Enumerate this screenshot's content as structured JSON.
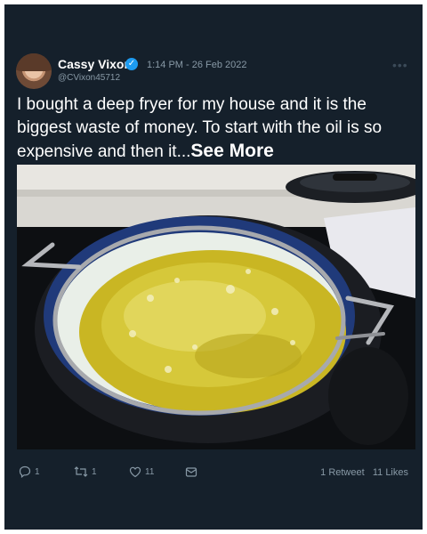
{
  "user": {
    "name": "Cassy Vixon",
    "handle": "@CVixon45712",
    "timestamp": "1:14 PM - 26 Feb 2022",
    "verified": true
  },
  "tweet": {
    "text": "I bought a deep fryer for my house and it is the biggest waste of money. To start with the oil is so expensive and then it...",
    "see_more": "See More"
  },
  "actions": {
    "reply_count": "1",
    "retweet_count": "1",
    "like_count": "11"
  },
  "stats": {
    "retweets_label": "1 Retweet",
    "likes_label": "11 Likes"
  },
  "icons": [
    "reply-icon",
    "retweet-icon",
    "like-icon",
    "share-icon",
    "more-icon",
    "verified-icon"
  ]
}
